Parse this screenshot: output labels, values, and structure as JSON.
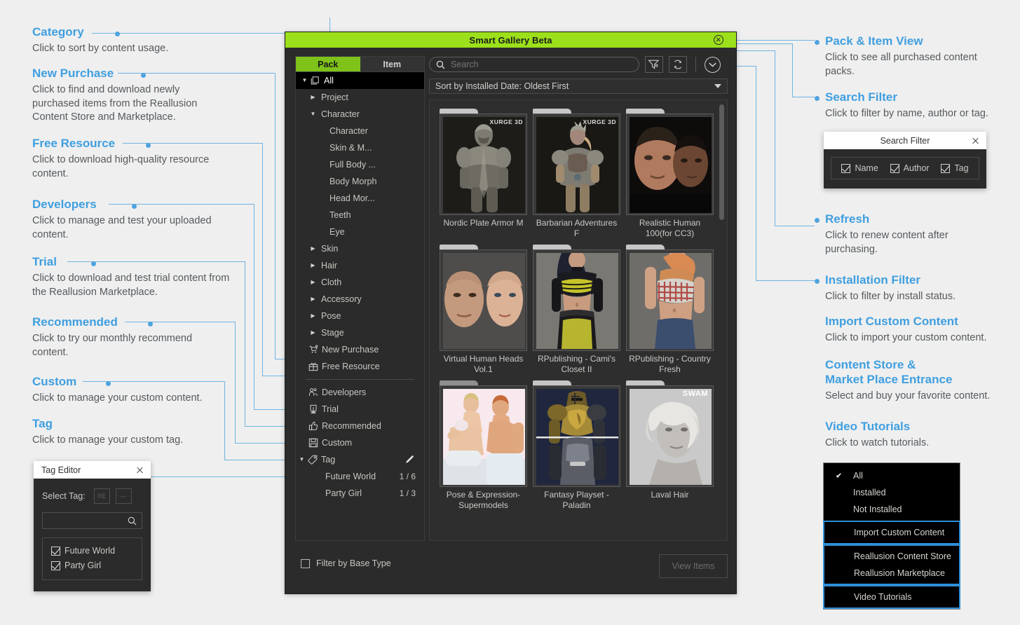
{
  "colors": {
    "accent_blue": "#3f9fe0",
    "connector_blue": "#6fb4e3",
    "title_green": "#9ce01b",
    "tab_green": "#7ec21a",
    "page_bg": "#efefef",
    "window_bg": "#2b2b2b",
    "menu_highlight": "#2f8fd8"
  },
  "left_annotations": [
    {
      "title": "Category",
      "body": "Click to sort by content usage."
    },
    {
      "title": "New Purchase",
      "body": "Click to find and download newly purchased items from the Reallusion Content Store and Marketplace."
    },
    {
      "title": "Free Resource",
      "body": "Click to download high-quality resource content."
    },
    {
      "title": "Developers",
      "body": "Click to manage and test your uploaded content."
    },
    {
      "title": "Trial",
      "body": "Click to download and test trial content from the Reallusion Marketplace."
    },
    {
      "title": "Recommended",
      "body": "Click to try our monthly recommend content."
    },
    {
      "title": "Custom",
      "body": "Click to manage your custom content."
    },
    {
      "title": "Tag",
      "body": "Click to manage your custom tag."
    }
  ],
  "right_annotations": [
    {
      "title": "Pack & Item View",
      "body": "Click to see all purchased content packs."
    },
    {
      "title": "Search Filter",
      "body": "Click to filter by name, author or tag."
    },
    {
      "title": "Refresh",
      "body": "Click to renew content after purchasing."
    },
    {
      "title": "Installation Filter",
      "body": "Click to filter by install status."
    },
    {
      "title": "Import Custom Content",
      "body": "Click to import your custom content."
    },
    {
      "title": "Content Store &\nMarket Place Entrance",
      "title_line1": "Content Store &",
      "title_line2": "Market Place Entrance",
      "body": "Select and buy your favorite content."
    },
    {
      "title": "Video Tutorials",
      "body": "Click to watch tutorials."
    }
  ],
  "window": {
    "title": "Smart Gallery Beta",
    "close_icon": "close-circle-icon",
    "tabs": [
      {
        "label": "Pack",
        "active": true
      },
      {
        "label": "Item",
        "active": false
      }
    ],
    "search": {
      "placeholder": "Search",
      "value": "",
      "icon": "search-icon"
    },
    "toolbar_buttons": [
      {
        "name": "search-filter-button",
        "icon": "funnel-icon"
      },
      {
        "name": "refresh-button",
        "icon": "refresh-icon"
      },
      {
        "name": "installation-filter-button",
        "icon": "chevron-down-circle-icon"
      }
    ],
    "sort": {
      "label": "Sort by Installed Date: Oldest First",
      "icon": "caret-down-icon"
    },
    "tree": [
      {
        "label": "All",
        "indent": 0,
        "twisty": "down",
        "icon": "stacked-pages-icon",
        "selected": true
      },
      {
        "label": "Project",
        "indent": 1,
        "twisty": "right",
        "icon": ""
      },
      {
        "label": "Character",
        "indent": 1,
        "twisty": "down",
        "icon": ""
      },
      {
        "label": "Character",
        "indent": 2,
        "twisty": "",
        "icon": ""
      },
      {
        "label": "Skin & M...",
        "indent": 2,
        "twisty": "",
        "icon": ""
      },
      {
        "label": "Full Body ...",
        "indent": 2,
        "twisty": "",
        "icon": ""
      },
      {
        "label": "Body Morph",
        "indent": 2,
        "twisty": "",
        "icon": ""
      },
      {
        "label": "Head Mor...",
        "indent": 2,
        "twisty": "",
        "icon": ""
      },
      {
        "label": "Teeth",
        "indent": 2,
        "twisty": "",
        "icon": ""
      },
      {
        "label": "Eye",
        "indent": 2,
        "twisty": "",
        "icon": ""
      },
      {
        "label": "Skin",
        "indent": 1,
        "twisty": "right",
        "icon": ""
      },
      {
        "label": "Hair",
        "indent": 1,
        "twisty": "right",
        "icon": ""
      },
      {
        "label": "Cloth",
        "indent": 1,
        "twisty": "right",
        "icon": ""
      },
      {
        "label": "Accessory",
        "indent": 1,
        "twisty": "right",
        "icon": ""
      },
      {
        "label": "Pose",
        "indent": 1,
        "twisty": "right",
        "icon": ""
      },
      {
        "label": "Stage",
        "indent": 1,
        "twisty": "right",
        "icon": ""
      }
    ],
    "tree_special": [
      {
        "label": "New Purchase",
        "icon": "cart-icon"
      },
      {
        "label": "Free Resource",
        "icon": "gift-icon"
      }
    ],
    "tree_special2": [
      {
        "label": "Developers",
        "icon": "people-icon"
      },
      {
        "label": "Trial",
        "icon": "download-icon"
      },
      {
        "label": "Recommended",
        "icon": "thumbs-up-icon"
      },
      {
        "label": "Custom",
        "icon": "save-disk-icon"
      }
    ],
    "tree_tag": {
      "label": "Tag",
      "icon": "tag-icon",
      "edit_icon": "pencil-icon",
      "twisty": "down"
    },
    "tree_tags": [
      {
        "label": "Future World",
        "count": "1 / 6"
      },
      {
        "label": "Party Girl",
        "count": "1 / 3"
      }
    ],
    "cards": [
      {
        "title": "Nordic Plate Armor M",
        "brand": "XURGE 3D",
        "tab": "bright"
      },
      {
        "title": "Barbarian Adventures F",
        "brand": "XURGE 3D",
        "tab": "bright"
      },
      {
        "title": "Realistic Human 100(for CC3)",
        "brand": "",
        "tab": "bright"
      },
      {
        "title": "Virtual Human Heads Vol.1",
        "brand": "",
        "tab": "bright"
      },
      {
        "title": "RPublishing - Cami's Closet II",
        "brand": "",
        "tab": "bright"
      },
      {
        "title": "RPublishing - Country Fresh",
        "brand": "",
        "tab": "bright"
      },
      {
        "title": "Pose & Expression-Supermodels",
        "brand": "",
        "tab": "dim"
      },
      {
        "title": "Fantasy Playset - Paladin",
        "brand": "",
        "tab": "bright"
      },
      {
        "title": "Laval Hair",
        "brand": "SWAM",
        "tab": "bright"
      }
    ],
    "filter_base_type": {
      "label": "Filter by Base Type",
      "checked": false
    },
    "view_items_button": {
      "label": "View Items",
      "disabled": true
    }
  },
  "search_filter_popup": {
    "title": "Search Filter",
    "close_icon": "close-icon",
    "options": [
      {
        "label": "Name",
        "checked": true
      },
      {
        "label": "Author",
        "checked": true
      },
      {
        "label": "Tag",
        "checked": true
      }
    ]
  },
  "tag_editor_popup": {
    "title": "Tag Editor",
    "close_icon": "close-icon",
    "select_tag_label": "Select Tag:",
    "add_button_value": "RE",
    "remove_button_value": "—",
    "search_placeholder": "",
    "search_icon": "search-icon",
    "tags": [
      {
        "label": "Future World",
        "checked": true
      },
      {
        "label": "Party Girl",
        "checked": true
      }
    ]
  },
  "install_menu": {
    "items": [
      {
        "label": "All",
        "checked": true,
        "group": 0
      },
      {
        "label": "Installed",
        "checked": false,
        "group": 0
      },
      {
        "label": "Not Installed",
        "checked": false,
        "group": 0
      },
      {
        "label": "Import Custom Content",
        "checked": false,
        "group": 1
      },
      {
        "label": "Reallusion Content Store",
        "checked": false,
        "group": 2
      },
      {
        "label": "Reallusion Marketplace",
        "checked": false,
        "group": 2
      },
      {
        "label": "Video Tutorials",
        "checked": false,
        "group": 3
      }
    ]
  }
}
